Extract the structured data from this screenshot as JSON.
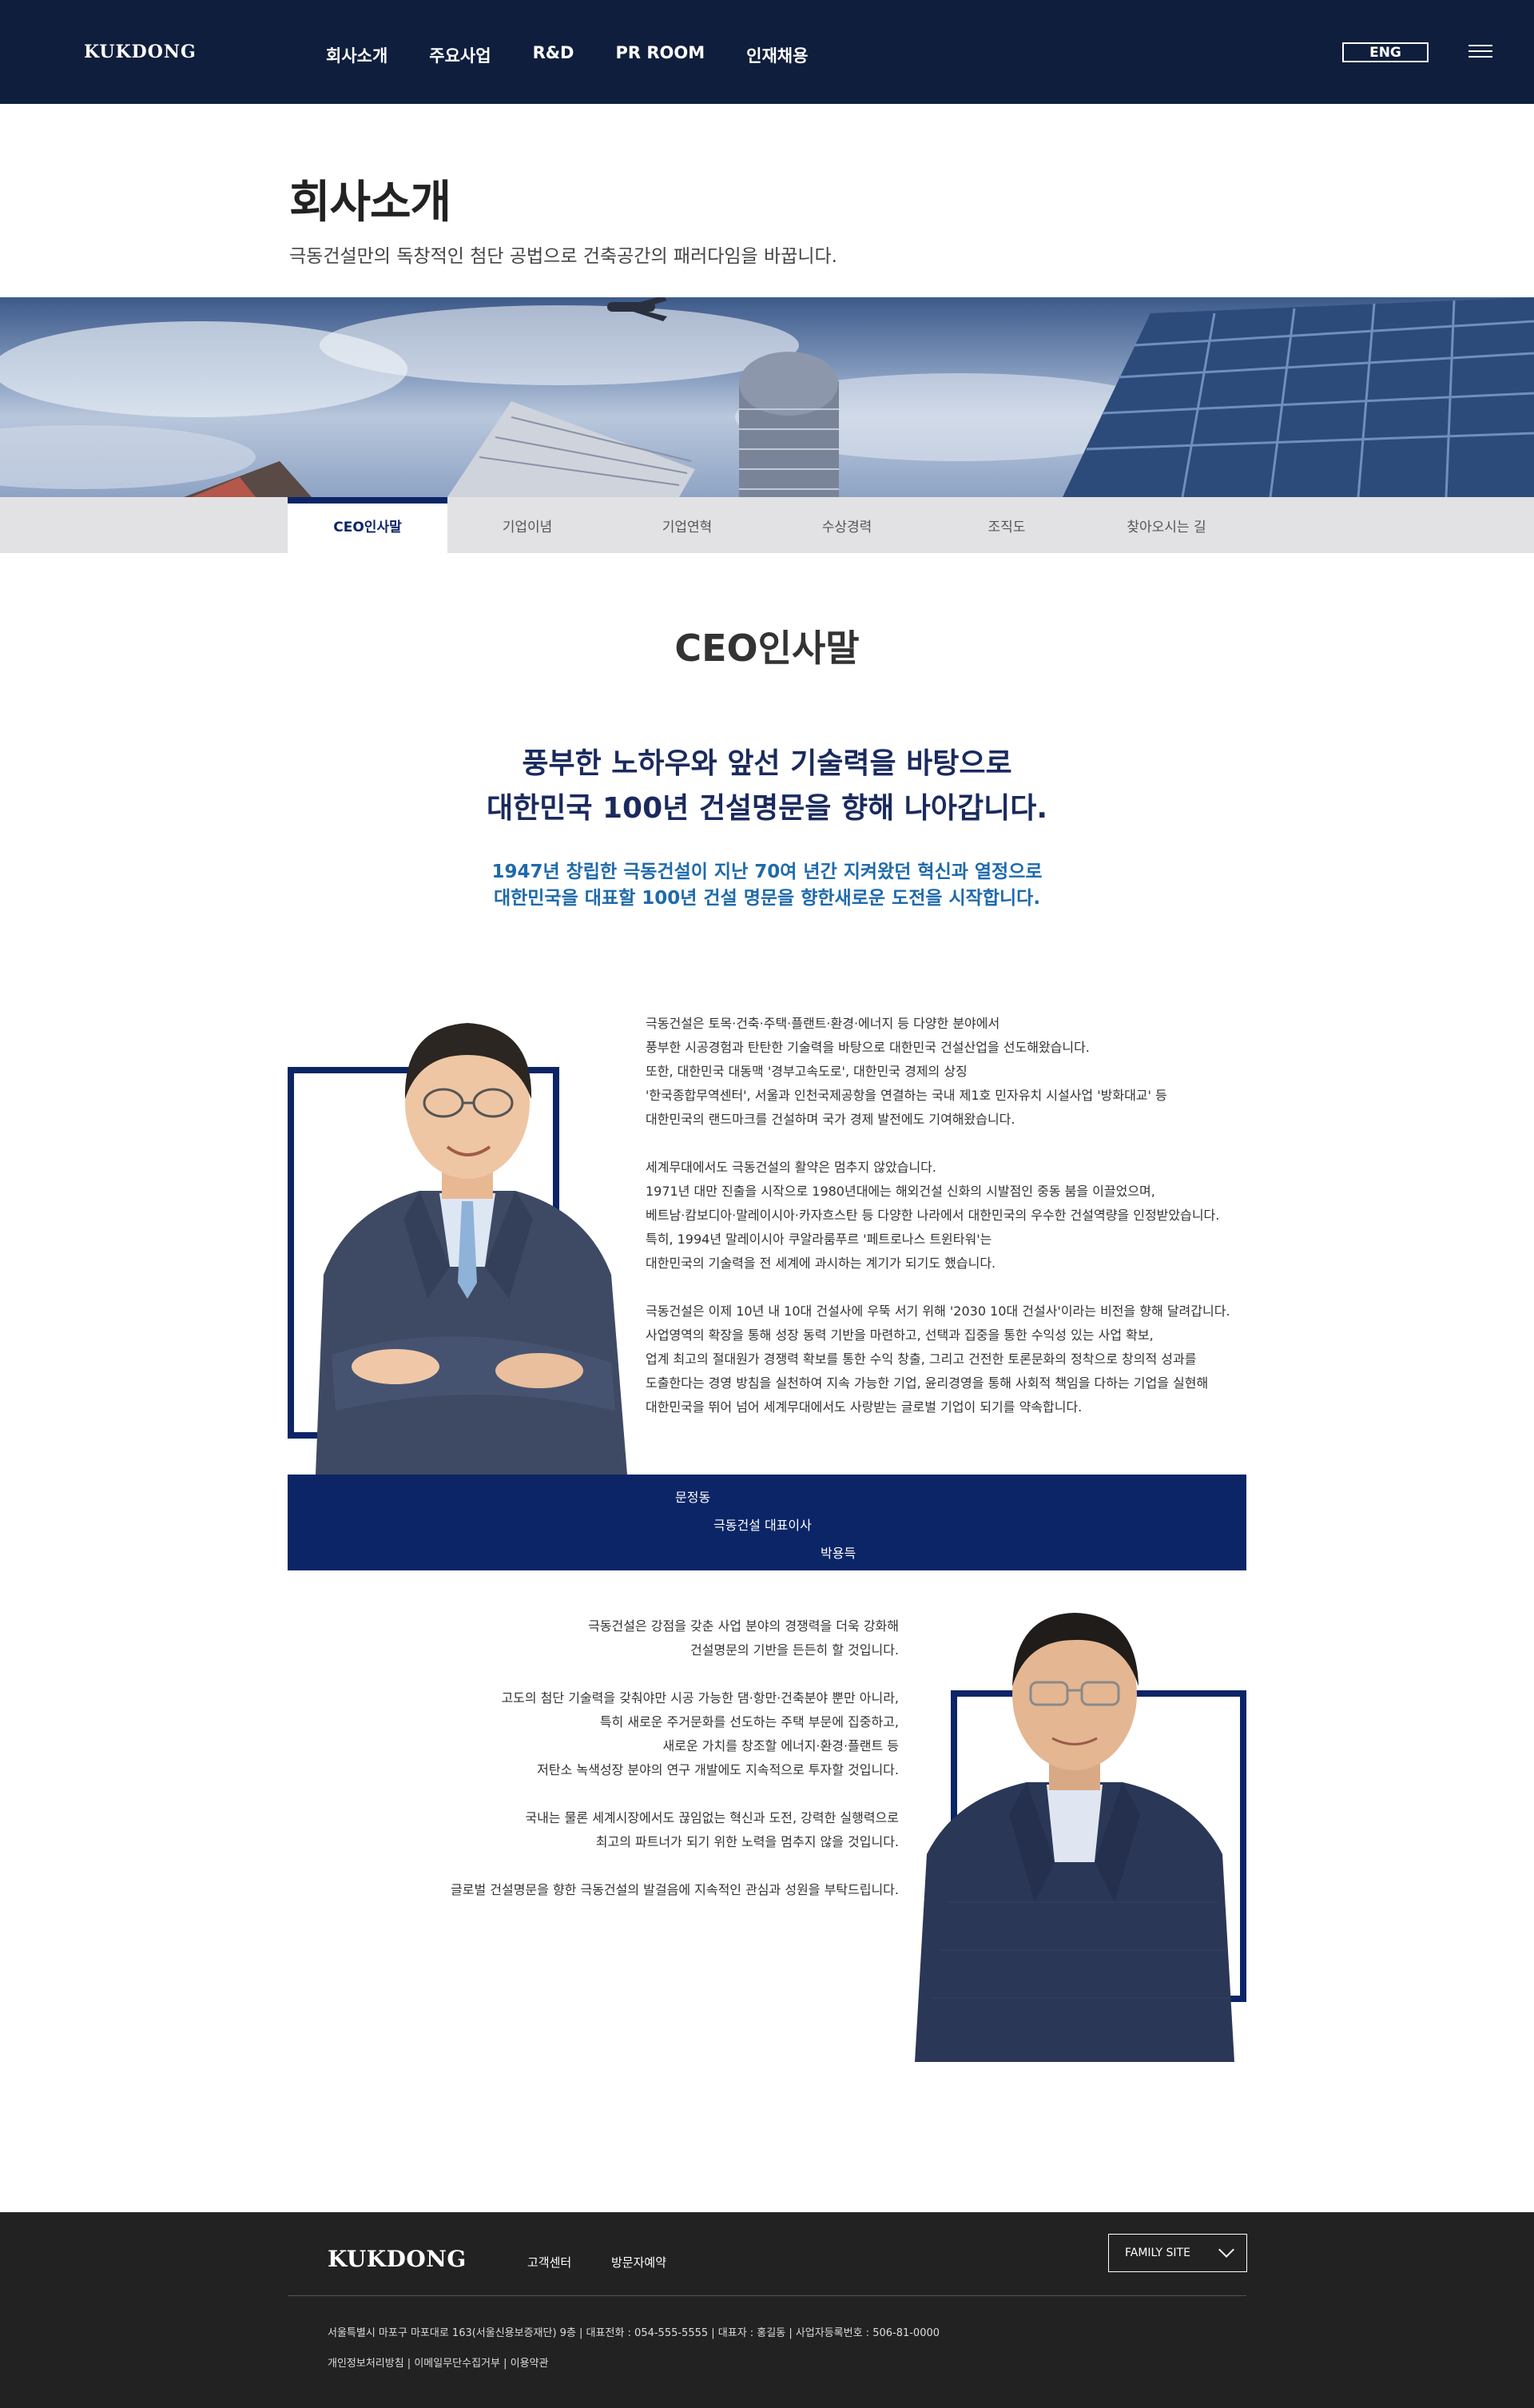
{
  "header": {
    "logo": "KUKDONG",
    "nav": [
      "회사소개",
      "주요사업",
      "R&D",
      "PR ROOM",
      "인재채용"
    ],
    "lang": "ENG"
  },
  "page": {
    "title": "회사소개",
    "subtitle": "극동건설만의 독창적인 첨단 공법으로 건축공간의 패러다임을 바꿉니다."
  },
  "tabs": [
    "CEO인사말",
    "기업이념",
    "기업연혁",
    "수상경력",
    "조직도",
    "찾아오시는 길"
  ],
  "section": {
    "title": "CEO인사말",
    "headline": [
      "풍부한 노하우와 앞선 기술력을 바탕으로",
      "대한민국 100년 건설명문을 향해 나아갑니다."
    ],
    "subline": [
      "1947년 창립한 극동건설이 지난 70여 년간 지켜왔던 혁신과 열정으로",
      "대한민국을 대표할 100년 건설 명문을 향한새로운 도전을 시작합니다."
    ]
  },
  "ceo1": {
    "paragraphs": [
      [
        "극동건설은 토목·건축·주택·플랜트·환경·에너지 등 다양한 분야에서",
        "풍부한 시공경험과 탄탄한 기술력을 바탕으로 대한민국 건설산업을 선도해왔습니다.",
        "또한, 대한민국 대동맥 '경부고속도로', 대한민국 경제의 상징",
        "'한국종합무역센터', 서울과 인천국제공항을 연결하는 국내 제1호 민자유치 시설사업 '방화대교' 등",
        "대한민국의 랜드마크를 건설하며 국가 경제 발전에도 기여해왔습니다."
      ],
      [
        "세계무대에서도 극동건설의 활약은 멈추지 않았습니다.",
        "1971년 대만 진출을 시작으로 1980년대에는 해외건설 신화의 시발점인 중동 붐을 이끌었으며,",
        "베트남·캄보디아·말레이시아·카자흐스탄 등 다양한 나라에서 대한민국의 우수한 건설역량을 인정받았습니다.",
        "특히, 1994년 말레이시아 쿠알라룸푸르 '페트로나스 트윈타워'는",
        "대한민국의 기술력을 전 세계에 과시하는 계기가 되기도 했습니다."
      ],
      [
        "극동건설은 이제 10년 내 10대 건설사에 우뚝 서기 위해 '2030 10대 건설사'이라는 비전을 향해 달려갑니다.",
        "사업영역의 확장을 통해 성장 동력 기반을 마련하고, 선택과 집중을 통한 수익성 있는 사업 확보,",
        "업계 최고의 절대원가 경쟁력 확보를 통한 수익 창출, 그리고 건전한 토론문화의 정착으로 창의적 성과를",
        "도출한다는 경영 방침을 실천하여 지속 가능한 기업, 윤리경영을 통해 사회적 책임을 다하는 기업을 실현해",
        "대한민국을 뛰어 넘어 세계무대에서도 사랑받는 글로벌 기업이 되기를 약속합니다."
      ]
    ]
  },
  "banner": {
    "name1": "문정동",
    "position": "극동건설 대표이사",
    "name2": "박용득"
  },
  "ceo2": {
    "paragraphs": [
      [
        "극동건설은 강점을 갖춘 사업 분야의 경쟁력을 더욱 강화해",
        "건설명문의 기반을 든든히 할 것입니다."
      ],
      [
        "고도의 첨단 기술력을 갖춰야만 시공 가능한 댐·항만·건축분야 뿐만 아니라,",
        "특히 새로운 주거문화를 선도하는 주택 부문에 집중하고,",
        "새로운 가치를 창조할 에너지·환경·플랜트 등",
        "저탄소 녹색성장 분야의 연구 개발에도 지속적으로 투자할 것입니다."
      ],
      [
        "국내는 물론 세계시장에서도 끊임없는 혁신과 도전, 강력한 실행력으로",
        "최고의 파트너가 되기 위한 노력을 멈추지 않을 것입니다."
      ],
      [
        "글로벌 건설명문을 향한 극동건설의 발걸음에 지속적인 관심과 성원을 부탁드립니다."
      ]
    ]
  },
  "footer": {
    "logo": "KUKDONG",
    "links": [
      "고객센터",
      "방문자예약"
    ],
    "family_site": "FAMILY SITE",
    "address": "서울특별시 마포구 마포대로 163(서울신용보증재단) 9층 | 대표전화 : 054-555-5555 | 대표자 : 홍길동 | 사업자등록번호 : 506-81-0000",
    "policy": "개인정보처리방침 | 이메일무단수집거부 | 이용약관"
  },
  "colors": {
    "navy": "#0f1e3c",
    "brand_blue": "#0b2566",
    "accent_blue": "#1f6aab",
    "footer_bg": "#222222"
  },
  "icons": [
    "hamburger-menu-icon",
    "chevron-down-icon"
  ]
}
